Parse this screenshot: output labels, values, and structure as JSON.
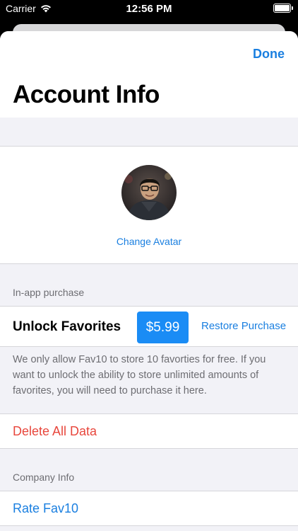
{
  "status_bar": {
    "carrier": "Carrier",
    "time": "12:56 PM"
  },
  "nav": {
    "done_label": "Done",
    "title": "Account Info"
  },
  "avatar": {
    "change_label": "Change Avatar"
  },
  "in_app_purchase": {
    "header": "In-app purchase",
    "item_title": "Unlock Favorites",
    "price": "$5.99",
    "restore_label": "Restore Purchase",
    "footer": "We only allow Fav10 to store 10 favorties for free. If you want to unlock the ability to store unlimited amounts of favorites, you will need to purchase it here."
  },
  "delete_row": {
    "label": "Delete All Data"
  },
  "company_info": {
    "header": "Company Info",
    "rate_label": "Rate Fav10"
  },
  "colors": {
    "accent": "#1a7fe0",
    "price_button": "#1a8cf5",
    "destructive": "#e8473d",
    "grouped_background": "#f2f2f7"
  },
  "icons": {
    "wifi": "wifi-icon",
    "battery": "battery-icon",
    "avatar": "user-photo"
  }
}
